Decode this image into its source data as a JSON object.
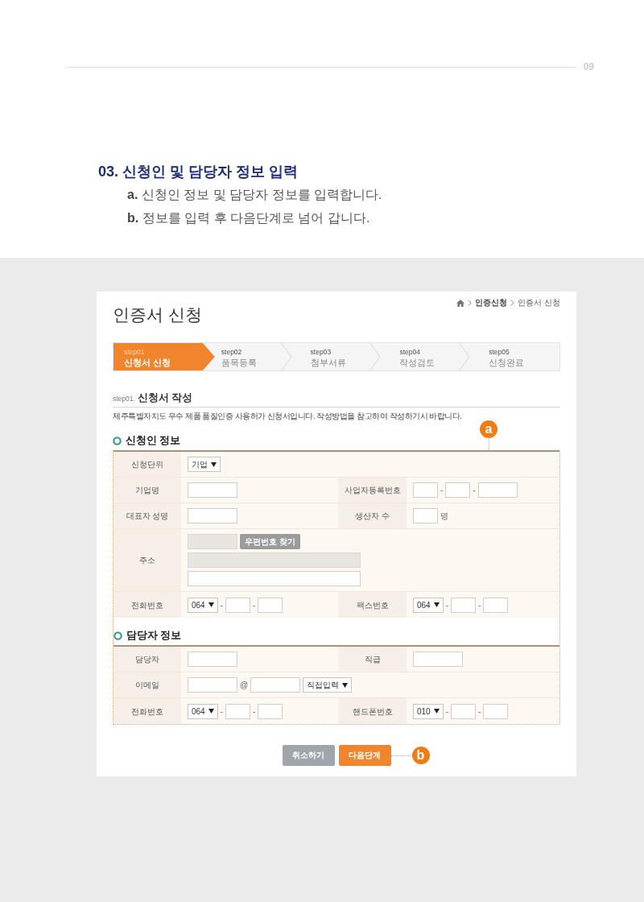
{
  "page_number": "09",
  "heading": "03. 신청인 및 담당자 정보 입력",
  "notes": [
    "**a.** 신청인 정보 및 담당자 정보를 입력합니다.",
    "**b.** 정보를 입력 후 다음단계로 넘어 갑니다."
  ],
  "screen": {
    "title": "인증서 신청",
    "breadcrumb": [
      "인증신청",
      "인증서 신청"
    ],
    "steps": [
      {
        "number": "step01",
        "label": "신청서 신청",
        "selected": true
      },
      {
        "number": "step02",
        "label": "품목등록",
        "selected": false
      },
      {
        "number": "step03",
        "label": "첨부서류",
        "selected": false
      },
      {
        "number": "step04",
        "label": "작성검토",
        "selected": false
      },
      {
        "number": "step05",
        "label": "신청완료",
        "selected": false
      }
    ],
    "form_heading": {
      "prefix": "step01.",
      "title": "신청서 작성"
    },
    "description": "제주특별자치도 우수 제품 품질인증 사용허가 신청서입니다. 작성방법을 참고하여 작성하기시 바랍니다.",
    "form_callout": "a",
    "sections": [
      {
        "title": "신청인 정보",
        "rows": [
          {
            "cells": [
              {
                "label": "신청단위",
                "fields": [
                  {
                    "kind": "select",
                    "value": "기업",
                    "disabled": false
                  }
                ]
              }
            ]
          },
          {
            "cells": [
              {
                "label": "기업명",
                "fields": [
                  {
                    "kind": "text",
                    "disabled": false
                  }
                ]
              },
              {
                "label": "사업자등록번호",
                "fields": [
                  {
                    "kind": "short",
                    "disabled": false
                  },
                  {
                    "kind": "separator",
                    "text": "-"
                  },
                  {
                    "kind": "short",
                    "disabled": false
                  },
                  {
                    "kind": "separator",
                    "text": "-"
                  },
                  {
                    "kind": "medium",
                    "disabled": false
                  }
                ]
              }
            ]
          },
          {
            "cells": [
              {
                "label": "대표자 성명",
                "fields": [
                  {
                    "kind": "text",
                    "disabled": false
                  }
                ]
              },
              {
                "label": "생산자 수",
                "fields": [
                  {
                    "kind": "short",
                    "disabled": false
                  },
                  {
                    "kind": "unit",
                    "text": "명"
                  }
                ]
              }
            ]
          },
          {
            "cells": [
              {
                "label": "주소",
                "lines": [
                  [
                    {
                      "kind": "text",
                      "disabled": true
                    },
                    {
                      "kind": "button",
                      "text": "우편번호 찾기"
                    }
                  ],
                  [
                    {
                      "kind": "long",
                      "disabled": true
                    }
                  ],
                  [
                    {
                      "kind": "long",
                      "disabled": false
                    }
                  ]
                ]
              }
            ]
          },
          {
            "cells": [
              {
                "label": "전화번호",
                "fields": [
                  {
                    "kind": "select",
                    "value": "064",
                    "disabled": false
                  },
                  {
                    "kind": "separator",
                    "text": "-"
                  },
                  {
                    "kind": "short",
                    "disabled": false
                  },
                  {
                    "kind": "separator",
                    "text": "-"
                  },
                  {
                    "kind": "short",
                    "disabled": false
                  }
                ]
              },
              {
                "label": "팩스번호",
                "fields": [
                  {
                    "kind": "select",
                    "value": "064",
                    "disabled": false
                  },
                  {
                    "kind": "separator",
                    "text": "-"
                  },
                  {
                    "kind": "short",
                    "disabled": false
                  },
                  {
                    "kind": "separator",
                    "text": "-"
                  },
                  {
                    "kind": "short",
                    "disabled": false
                  }
                ]
              }
            ]
          }
        ]
      },
      {
        "title": "담당자 정보",
        "rows": [
          {
            "cells": [
              {
                "label": "담당자",
                "fields": [
                  {
                    "kind": "text",
                    "disabled": false
                  }
                ]
              },
              {
                "label": "직급",
                "fields": [
                  {
                    "kind": "text",
                    "disabled": false
                  }
                ]
              }
            ]
          },
          {
            "cells": [
              {
                "label": "이메일",
                "fields": [
                  {
                    "kind": "text",
                    "disabled": false
                  },
                  {
                    "kind": "separator",
                    "text": "@"
                  },
                  {
                    "kind": "text",
                    "disabled": false
                  },
                  {
                    "kind": "select",
                    "value": "직접입력",
                    "disabled": false
                  }
                ]
              }
            ]
          },
          {
            "cells": [
              {
                "label": "전화번호",
                "fields": [
                  {
                    "kind": "select",
                    "value": "064",
                    "disabled": false
                  },
                  {
                    "kind": "separator",
                    "text": "-"
                  },
                  {
                    "kind": "short",
                    "disabled": false
                  },
                  {
                    "kind": "separator",
                    "text": "-"
                  },
                  {
                    "kind": "short",
                    "disabled": false
                  }
                ]
              },
              {
                "label": "핸드폰번호",
                "fields": [
                  {
                    "kind": "select",
                    "value": "010",
                    "disabled": false
                  },
                  {
                    "kind": "separator",
                    "text": "-"
                  },
                  {
                    "kind": "short",
                    "disabled": false
                  },
                  {
                    "kind": "separator",
                    "text": "-"
                  },
                  {
                    "kind": "short",
                    "disabled": false
                  }
                ]
              }
            ]
          }
        ]
      }
    ],
    "buttons": [
      {
        "label": "취소하기",
        "kind": "cancel"
      },
      {
        "label": "다음단계",
        "kind": "next",
        "callout": "b"
      }
    ]
  }
}
